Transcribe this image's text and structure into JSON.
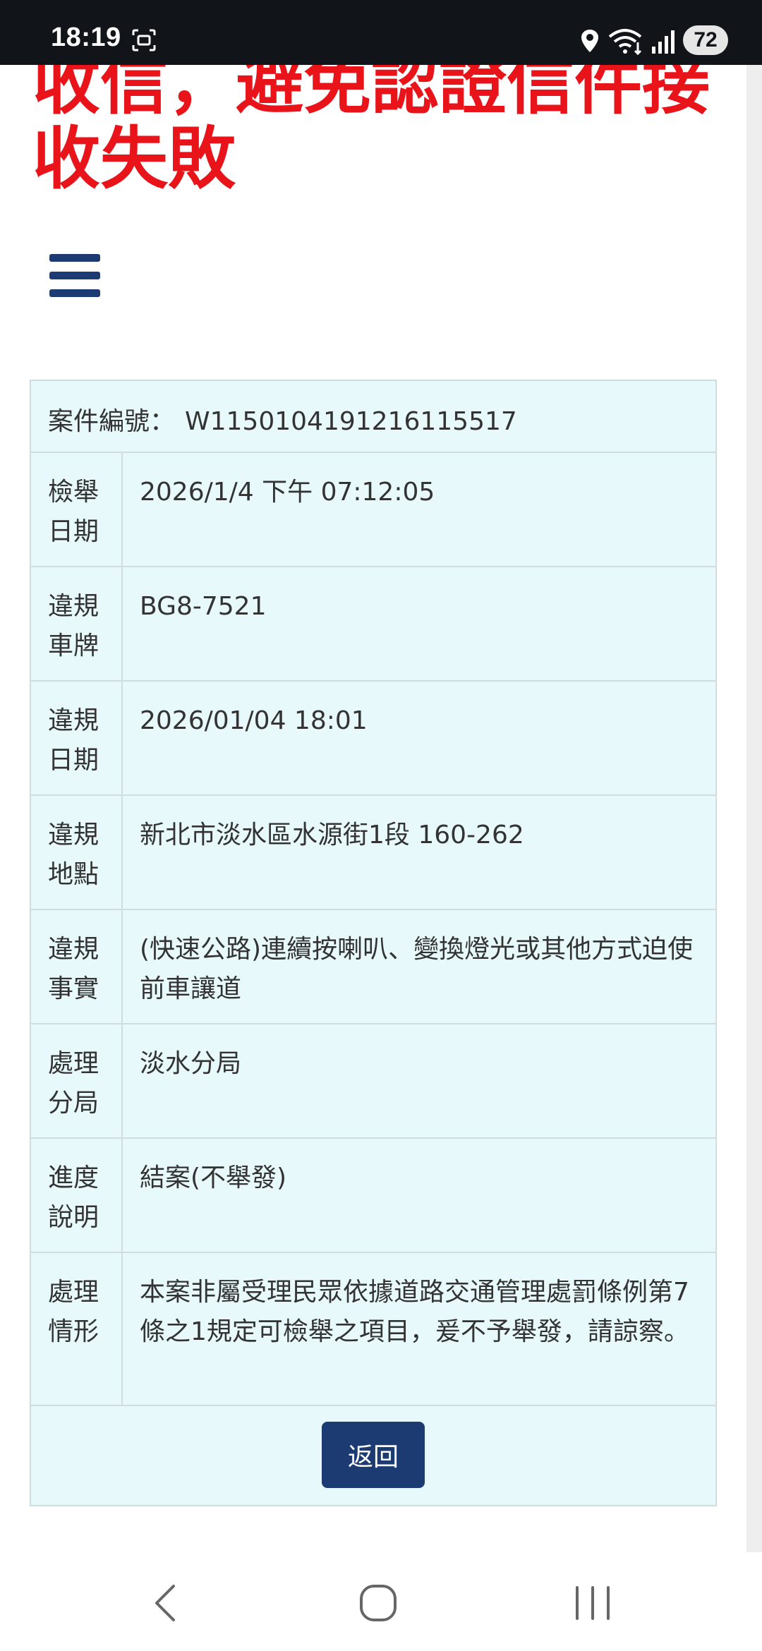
{
  "status_bar": {
    "time": "18:19",
    "battery": "72",
    "icons": [
      "screenshot-icon",
      "location-icon",
      "wifi-icon",
      "signal-icon",
      "battery-icon"
    ]
  },
  "heading": {
    "line1": "收信，避免認證信件接",
    "line2": "收失敗"
  },
  "menu": {
    "icon": "hamburger-menu-icon"
  },
  "case": {
    "label": "案件編號：",
    "number": "W1150104191216115517"
  },
  "details": [
    {
      "label": "檢舉日期",
      "value": "2026/1/4 下午 07:12:05"
    },
    {
      "label": "違規車牌",
      "value": "BG8-7521"
    },
    {
      "label": "違規日期",
      "value": "2026/01/04 18:01"
    },
    {
      "label": "違規地點",
      "value": "新北市淡水區水源街1段 160-262"
    },
    {
      "label": "違規事實",
      "value": "(快速公路)連續按喇叭、變換燈光或其他方式迫使前車讓道"
    },
    {
      "label": "處理分局",
      "value": "淡水分局"
    },
    {
      "label": "進度說明",
      "value": "結案(不舉發)"
    },
    {
      "label": "處理情形",
      "value": "本案非屬受理民眾依據道路交通管理處罰條例第7條之1規定可檢舉之項目，爰不予舉發，請諒察。"
    }
  ],
  "actions": {
    "back_label": "返回"
  },
  "colors": {
    "heading_red": "#e8141a",
    "brand_navy": "#1d3b73",
    "table_bg": "#e8f9fb",
    "status_bar_bg": "#111418"
  },
  "nav_bar": {
    "icons": [
      "back-nav-icon",
      "home-nav-icon",
      "recents-nav-icon"
    ]
  }
}
